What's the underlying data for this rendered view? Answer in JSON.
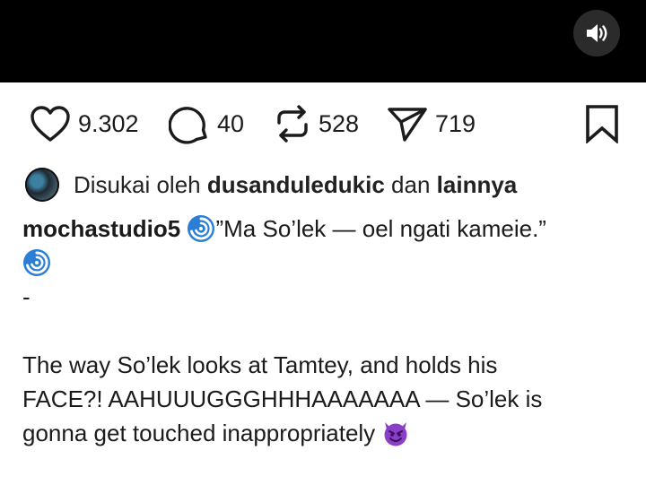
{
  "video": {
    "sound_icon": "speaker-icon"
  },
  "actions": {
    "likes": "9.302",
    "comments": "40",
    "reposts": "528",
    "shares": "719"
  },
  "liked_by": {
    "prefix": "Disukai oleh",
    "user": "dusanduledukic",
    "connector": "dan",
    "others": "lainnya"
  },
  "caption": {
    "username": "mochastudio5",
    "quote": "”Ma So’lek — oel ngati kameie.”",
    "separator": "-",
    "line1": "The way So’lek looks at Tamtey, and holds his",
    "line2": "FACE?! AAHUUUGGGHHHAAAAAAA — So’lek is",
    "line3": "gonna get touched inappropriately",
    "emoji_swirl": "cyclone-emoji",
    "emoji_end": "smiling-devil-emoji"
  },
  "colors": {
    "video_bg": "#000000",
    "text": "#1b1b1b",
    "swirl": "#2a7fd4",
    "devil": "#8b3fc8"
  }
}
